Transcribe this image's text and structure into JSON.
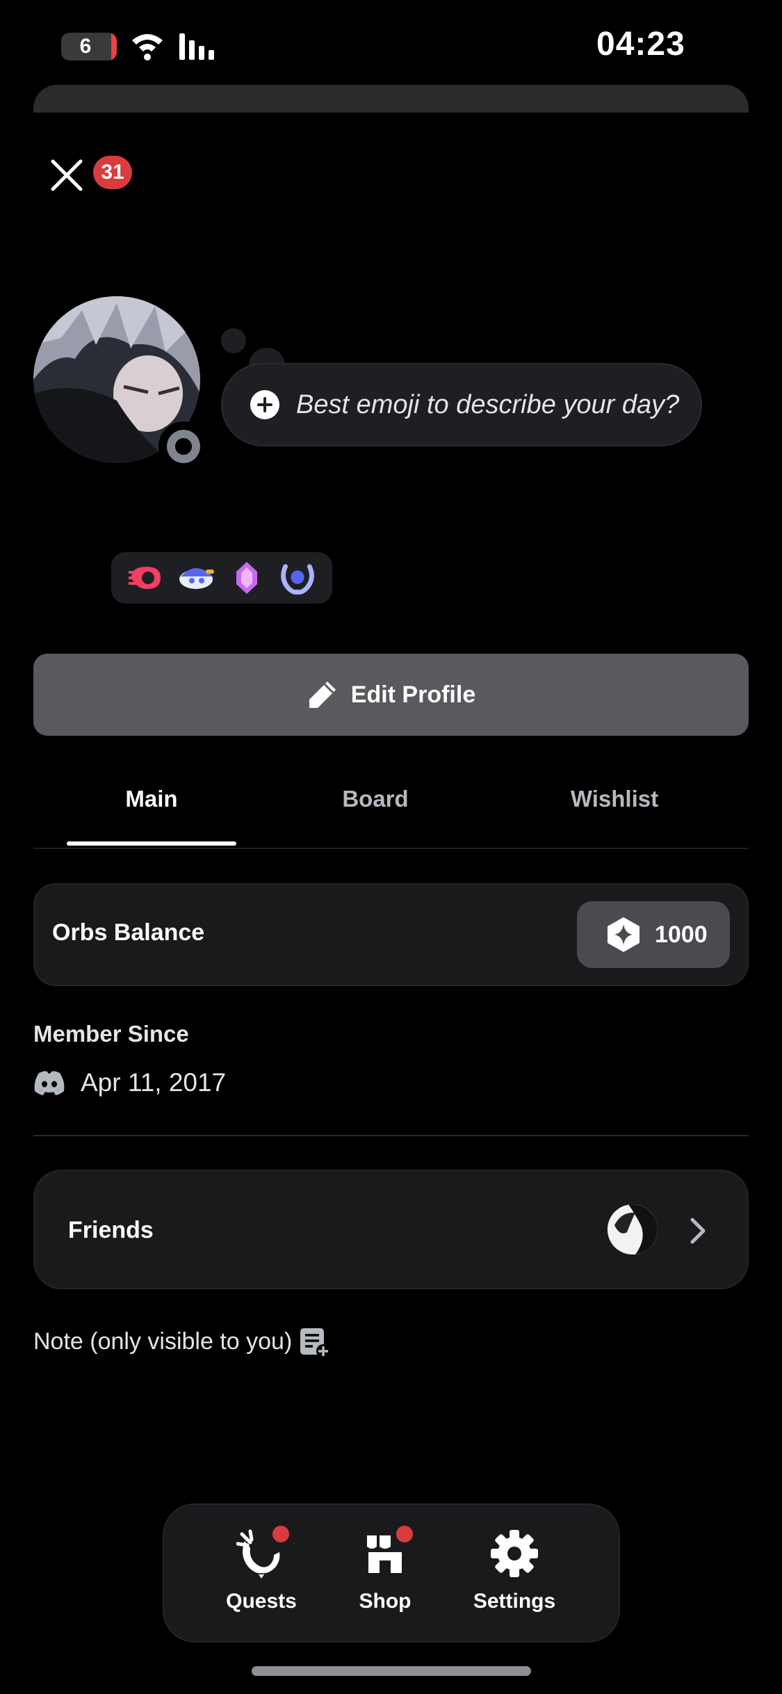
{
  "status_bar": {
    "time": "04:23",
    "battery_level": "6",
    "icons": [
      "wifi-icon",
      "signal-icon"
    ]
  },
  "header": {
    "close_icon": "close-icon",
    "notification_count": "31"
  },
  "profile": {
    "custom_status_placeholder": "Best emoji to describe your day?",
    "online_status": "idle-offline",
    "badges": [
      "hypesquad-badge",
      "early-supporter-badge",
      "nitro-boost-badge",
      "quest-completer-badge"
    ],
    "edit_profile_label": "Edit Profile"
  },
  "tabs": [
    {
      "label": "Main",
      "active": true
    },
    {
      "label": "Board",
      "active": false
    },
    {
      "label": "Wishlist",
      "active": false
    }
  ],
  "orbs": {
    "label": "Orbs Balance",
    "value": "1000"
  },
  "member_since": {
    "title": "Member Since",
    "date": "Apr 11, 2017"
  },
  "friends": {
    "label": "Friends"
  },
  "note": {
    "label": "Note (only visible to you)"
  },
  "bottom_nav": [
    {
      "label": "Quests",
      "icon": "quests-icon",
      "has_notification": true
    },
    {
      "label": "Shop",
      "icon": "shop-icon",
      "has_notification": true
    },
    {
      "label": "Settings",
      "icon": "gear-icon",
      "has_notification": false
    }
  ],
  "colors": {
    "background": "#000000",
    "card": "#1a1a1d",
    "accent_red": "#d83c3e",
    "button_gray": "#5a5a5e"
  }
}
